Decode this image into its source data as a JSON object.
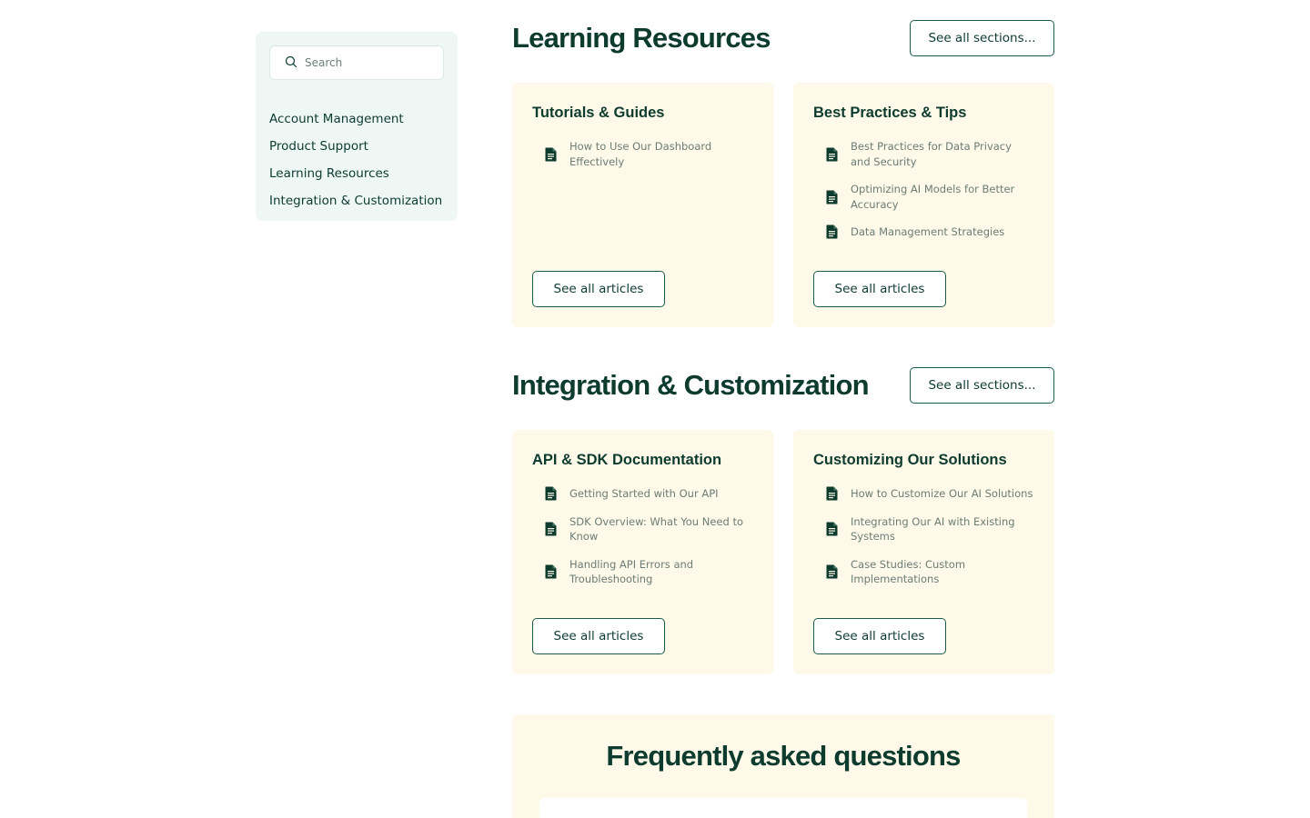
{
  "sidebar": {
    "search": {
      "placeholder": "Search",
      "icon": "search-icon"
    },
    "items": [
      {
        "label": "Account Management"
      },
      {
        "label": "Product Support"
      },
      {
        "label": "Learning Resources"
      },
      {
        "label": "Integration & Customization"
      }
    ]
  },
  "sections": [
    {
      "title": "Learning Resources",
      "see_all_label": "See all sections...",
      "cards": [
        {
          "title": "Tutorials & Guides",
          "articles": [
            "How to Use Our Dashboard Effectively"
          ],
          "button_label": "See all articles"
        },
        {
          "title": "Best Practices & Tips",
          "articles": [
            "Best Practices for Data Privacy and Security",
            "Optimizing AI Models for Better Accuracy",
            "Data Management Strategies"
          ],
          "button_label": "See all articles"
        }
      ]
    },
    {
      "title": "Integration & Customization",
      "see_all_label": "See all sections...",
      "cards": [
        {
          "title": "API & SDK Documentation",
          "articles": [
            "Getting Started with Our API",
            "SDK Overview: What You Need to Know",
            "Handling API Errors and Troubleshooting"
          ],
          "button_label": "See all articles"
        },
        {
          "title": "Customizing Our Solutions",
          "articles": [
            "How to Customize Our AI Solutions",
            "Integrating Our AI with Existing Systems",
            "Case Studies: Custom Implementations"
          ],
          "button_label": "See all articles"
        }
      ]
    }
  ],
  "faq": {
    "title": "Frequently asked questions"
  },
  "colors": {
    "primary": "#0d3b2e",
    "card_bg": "#fef9e8",
    "sidebar_bg": "#eef7f3",
    "muted_text": "#6b7d76"
  },
  "icons": {
    "article": "document-icon"
  }
}
